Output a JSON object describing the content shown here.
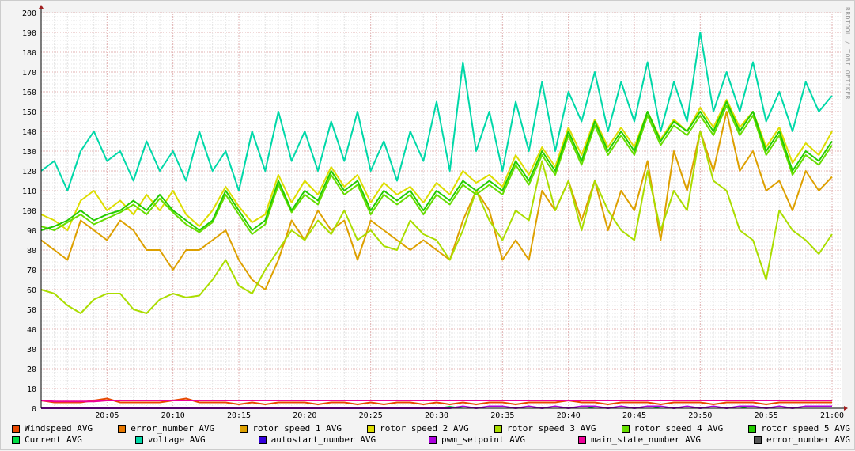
{
  "watermark": "RRDTOOL / TOBI OETIKER",
  "chart_data": {
    "type": "line",
    "title": "",
    "xlabel": "",
    "ylabel": "",
    "ylim": [
      0,
      200
    ],
    "yticks": [
      "0",
      "10",
      "20",
      "30",
      "40",
      "50",
      "60",
      "70",
      "80",
      "90",
      "100",
      "110",
      "120",
      "130",
      "140",
      "150",
      "160",
      "170",
      "180",
      "190",
      "200"
    ],
    "xlim_minutes": [
      0,
      60
    ],
    "xticks": [
      "20:05",
      "20:10",
      "20:15",
      "20:20",
      "20:25",
      "20:30",
      "20:35",
      "20:40",
      "20:45",
      "20:50",
      "20:55",
      "21:00"
    ],
    "x_step_minutes": 1,
    "grid": true,
    "legend_position": "bottom",
    "series": [
      {
        "name": "Windspeed AVG",
        "color": "#e84800",
        "width": 2,
        "values": [
          4,
          3,
          3,
          3,
          4,
          5,
          3,
          3,
          3,
          3,
          4,
          5,
          3,
          3,
          3,
          2,
          3,
          2,
          3,
          3,
          3,
          2,
          3,
          3,
          2,
          3,
          2,
          3,
          3,
          2,
          3,
          2,
          3,
          2,
          3,
          3,
          2,
          3,
          3,
          3,
          4,
          3,
          3,
          2,
          3,
          3,
          3,
          2,
          3,
          3,
          3,
          2,
          3,
          3,
          3,
          2,
          3,
          3,
          3,
          3,
          3
        ]
      },
      {
        "name": "error_number AVG",
        "color": "#e87800",
        "width": 1,
        "values": [
          0,
          0,
          0,
          0,
          0,
          0,
          0,
          0,
          0,
          0,
          0,
          0,
          0,
          0,
          0,
          0,
          0,
          0,
          0,
          0,
          0,
          0,
          0,
          0,
          0,
          0,
          0,
          0,
          0,
          0,
          0,
          0,
          0,
          0,
          0,
          0,
          0,
          0,
          0,
          0,
          0,
          0,
          0,
          0,
          0,
          0,
          0,
          0,
          0,
          0,
          0,
          0,
          0,
          0,
          0,
          0,
          0,
          0,
          0,
          0,
          0
        ]
      },
      {
        "name": "rotor speed 1 AVG",
        "color": "#dda000",
        "width": 2,
        "values": [
          85,
          80,
          75,
          95,
          90,
          85,
          95,
          90,
          80,
          80,
          70,
          80,
          80,
          85,
          90,
          75,
          65,
          60,
          75,
          95,
          85,
          100,
          90,
          95,
          75,
          95,
          90,
          85,
          80,
          85,
          80,
          75,
          95,
          110,
          100,
          75,
          85,
          75,
          110,
          100,
          115,
          95,
          115,
          90,
          110,
          100,
          125,
          85,
          130,
          110,
          140,
          120,
          150,
          120,
          130,
          110,
          115,
          100,
          120,
          110,
          117
        ]
      },
      {
        "name": "rotor speed 2 AVG",
        "color": "#dddd00",
        "width": 2,
        "values": [
          98,
          95,
          90,
          105,
          110,
          100,
          105,
          98,
          108,
          100,
          110,
          98,
          92,
          100,
          112,
          102,
          94,
          98,
          118,
          104,
          115,
          108,
          122,
          112,
          118,
          104,
          114,
          108,
          112,
          104,
          114,
          108,
          120,
          114,
          118,
          112,
          128,
          118,
          132,
          122,
          142,
          128,
          146,
          132,
          142,
          132,
          150,
          136,
          146,
          140,
          152,
          142,
          156,
          142,
          150,
          132,
          142,
          124,
          134,
          128,
          140
        ]
      },
      {
        "name": "rotor speed 3 AVG",
        "color": "#aadd00",
        "width": 2,
        "values": [
          60,
          58,
          52,
          48,
          55,
          58,
          58,
          50,
          48,
          55,
          58,
          56,
          57,
          65,
          75,
          62,
          58,
          70,
          80,
          90,
          85,
          95,
          88,
          100,
          85,
          90,
          82,
          80,
          95,
          88,
          85,
          75,
          90,
          110,
          95,
          85,
          100,
          95,
          125,
          100,
          115,
          90,
          115,
          100,
          90,
          85,
          120,
          90,
          110,
          100,
          140,
          115,
          110,
          90,
          85,
          65,
          100,
          90,
          85,
          78,
          88
        ]
      },
      {
        "name": "rotor speed 4 AVG",
        "color": "#66dd00",
        "width": 2,
        "values": [
          92,
          90,
          94,
          98,
          93,
          96,
          99,
          103,
          98,
          106,
          99,
          93,
          89,
          94,
          108,
          98,
          88,
          93,
          113,
          99,
          108,
          103,
          118,
          108,
          113,
          98,
          108,
          103,
          108,
          98,
          108,
          103,
          113,
          108,
          113,
          108,
          123,
          113,
          128,
          118,
          138,
          123,
          143,
          128,
          138,
          128,
          148,
          133,
          143,
          138,
          148,
          138,
          153,
          138,
          148,
          128,
          138,
          118,
          128,
          123,
          133
        ]
      },
      {
        "name": "rotor speed 5 AVG",
        "color": "#22cc00",
        "width": 2,
        "values": [
          90,
          92,
          95,
          100,
          95,
          98,
          100,
          105,
          100,
          108,
          100,
          95,
          90,
          95,
          110,
          100,
          90,
          95,
          115,
          100,
          110,
          105,
          120,
          110,
          115,
          100,
          110,
          105,
          110,
          100,
          110,
          105,
          115,
          110,
          115,
          110,
          125,
          115,
          130,
          120,
          140,
          125,
          145,
          130,
          140,
          130,
          150,
          135,
          145,
          140,
          150,
          140,
          155,
          140,
          150,
          130,
          140,
          120,
          130,
          125,
          135
        ]
      },
      {
        "name": "Current AVG",
        "color": "#00dd44",
        "width": 1,
        "values": [
          0,
          0,
          0,
          0,
          0,
          0,
          0,
          0,
          0,
          0,
          0,
          0,
          0,
          0,
          0,
          0,
          0,
          0,
          0,
          0,
          0,
          0,
          0,
          0,
          0,
          0,
          0,
          0,
          0,
          0,
          0,
          1,
          0,
          0,
          0,
          0,
          0,
          0,
          0,
          0,
          0,
          1,
          0,
          0,
          0,
          0,
          1,
          0,
          0,
          0,
          0,
          1,
          0,
          0,
          1,
          0,
          0,
          0,
          0,
          0,
          0
        ]
      },
      {
        "name": "voltage AVG",
        "color": "#00d8a8",
        "width": 2,
        "values": [
          120,
          125,
          110,
          130,
          140,
          125,
          130,
          115,
          135,
          120,
          130,
          115,
          140,
          120,
          130,
          110,
          140,
          120,
          150,
          125,
          140,
          120,
          145,
          125,
          150,
          120,
          135,
          115,
          140,
          125,
          155,
          120,
          175,
          130,
          150,
          120,
          155,
          130,
          165,
          130,
          160,
          145,
          170,
          140,
          165,
          145,
          175,
          140,
          165,
          145,
          190,
          150,
          170,
          150,
          175,
          145,
          160,
          140,
          165,
          150,
          158
        ]
      },
      {
        "name": "autostart_number AVG",
        "color": "#3300dd",
        "width": 1,
        "values": [
          0,
          0,
          0,
          0,
          0,
          0,
          0,
          0,
          0,
          0,
          0,
          0,
          0,
          0,
          0,
          0,
          0,
          0,
          0,
          0,
          0,
          0,
          0,
          0,
          0,
          0,
          0,
          0,
          0,
          0,
          0,
          0,
          0,
          0,
          0,
          0,
          0,
          0,
          0,
          0,
          0,
          0,
          0,
          0,
          0,
          0,
          0,
          0,
          0,
          0,
          0,
          0,
          0,
          0,
          0,
          0,
          0,
          0,
          0,
          0,
          0
        ]
      },
      {
        "name": "pwm_setpoint AVG",
        "color": "#aa00dd",
        "width": 2,
        "values": [
          0,
          0,
          0,
          0,
          0,
          0,
          0,
          0,
          0,
          0,
          0,
          0,
          0,
          0,
          0,
          0,
          0,
          0,
          0,
          0,
          0,
          0,
          0,
          0,
          0,
          0,
          0,
          0,
          0,
          0,
          0,
          0,
          1,
          0,
          1,
          1,
          0,
          1,
          0,
          1,
          0,
          1,
          1,
          0,
          1,
          0,
          1,
          1,
          0,
          1,
          0,
          1,
          0,
          1,
          1,
          0,
          1,
          0,
          1,
          1,
          1
        ]
      },
      {
        "name": "main_state_number AVG",
        "color": "#ee0099",
        "width": 2,
        "values": [
          4,
          3.5,
          3.5,
          3.5,
          3.5,
          4,
          4,
          4,
          4,
          4,
          4,
          4,
          4,
          4,
          4,
          4,
          4,
          4,
          4,
          4,
          4,
          4,
          4,
          4,
          4,
          4,
          4,
          4,
          4,
          4,
          4,
          4,
          4,
          4,
          4,
          4,
          4,
          4,
          4,
          4,
          4,
          4,
          4,
          4,
          4,
          4,
          4,
          4,
          4,
          4,
          4,
          4,
          4,
          4,
          4,
          4,
          4,
          4,
          4,
          4,
          4
        ]
      },
      {
        "name": "error_number AVG",
        "color": "#555555",
        "width": 1,
        "values": [
          0,
          0,
          0,
          0,
          0,
          0,
          0,
          0,
          0,
          0,
          0,
          0,
          0,
          0,
          0,
          0,
          0,
          0,
          0,
          0,
          0,
          0,
          0,
          0,
          0,
          0,
          0,
          0,
          0,
          0,
          0,
          0,
          0,
          0,
          0,
          0,
          0,
          0,
          0,
          0,
          0,
          0,
          0,
          0,
          0,
          0,
          0,
          0,
          0,
          0,
          0,
          0,
          0,
          0,
          0,
          0,
          0,
          0,
          0,
          0,
          0
        ]
      }
    ]
  }
}
